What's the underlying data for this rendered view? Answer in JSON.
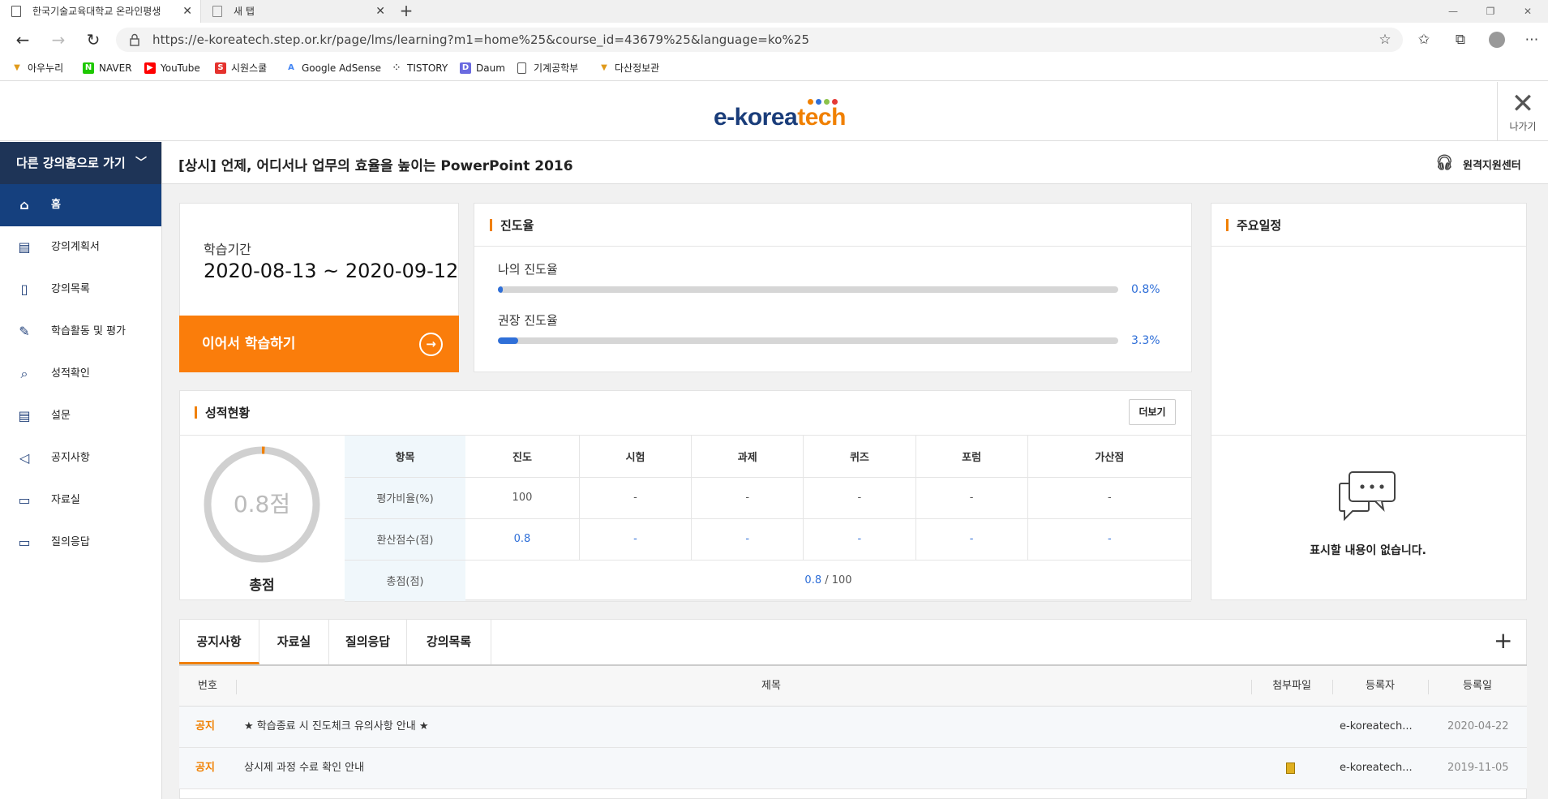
{
  "browser": {
    "tabs": [
      {
        "title": "한국기술교육대학교 온라인평생",
        "active": true
      },
      {
        "title": "새 탭",
        "active": false
      }
    ],
    "url": "https://e-koreatech.step.or.kr/page/lms/learning?m1=home%25&course_id=43679%25&language=ko%25",
    "bookmarks": [
      {
        "label": "아우누리",
        "icon": "shield-icon",
        "color": "#e09a1a"
      },
      {
        "label": "NAVER",
        "icon": "naver-icon",
        "color": "#1ec800"
      },
      {
        "label": "YouTube",
        "icon": "youtube-icon",
        "color": "#ff0000"
      },
      {
        "label": "시원스쿨",
        "icon": "s-icon",
        "color": "#e5322d"
      },
      {
        "label": "Google AdSense",
        "icon": "adsense-icon",
        "color": "#4285f4"
      },
      {
        "label": "TISTORY",
        "icon": "tistory-icon",
        "color": "#333333"
      },
      {
        "label": "Daum",
        "icon": "daum-icon",
        "color": "#6a6ae0"
      },
      {
        "label": "기계공학부",
        "icon": "page-icon",
        "color": "#555555"
      },
      {
        "label": "다산정보관",
        "icon": "shield-icon",
        "color": "#e09a1a"
      }
    ]
  },
  "site": {
    "logo_e": "e-korea",
    "logo_t": "tech",
    "exit_label": "나가기"
  },
  "sidebar": {
    "top_label": "다른 강의홈으로 가기",
    "items": [
      {
        "label": "홈",
        "icon": "home-icon",
        "active": true
      },
      {
        "label": "강의계획서",
        "icon": "book-open-icon"
      },
      {
        "label": "강의목록",
        "icon": "book-icon"
      },
      {
        "label": "학습활동 및 평가",
        "icon": "edit-icon"
      },
      {
        "label": "성적확인",
        "icon": "search-icon"
      },
      {
        "label": "설문",
        "icon": "document-icon"
      },
      {
        "label": "공지사항",
        "icon": "megaphone-icon"
      },
      {
        "label": "자료실",
        "icon": "folder-icon"
      },
      {
        "label": "질의응답",
        "icon": "chat-icon"
      }
    ]
  },
  "course": {
    "title": "[상시] 언제, 어디서나 업무의 효율을 높이는 PowerPoint 2016",
    "remote_label": "원격지원센터"
  },
  "period": {
    "label": "학습기간",
    "value": "2020-08-13 ~ 2020-09-12",
    "continue_label": "이어서 학습하기"
  },
  "progress": {
    "title": "진도율",
    "mine_label": "나의 진도율",
    "mine_value": "0.8%",
    "mine_fraction": 0.008,
    "rec_label": "권장 진도율",
    "rec_value": "3.3%",
    "rec_fraction": 0.033
  },
  "grades": {
    "title": "성적현황",
    "more_label": "더보기",
    "score_text": "0.8점",
    "score_fraction": 0.008,
    "total_label": "총점",
    "header": [
      "항목",
      "진도",
      "시험",
      "과제",
      "퀴즈",
      "포럼",
      "가산점"
    ],
    "rows": [
      [
        "평가비율(%)",
        "100",
        "-",
        "-",
        "-",
        "-",
        "-"
      ],
      [
        "환산점수(점)",
        "0.8",
        "-",
        "-",
        "-",
        "-",
        "-"
      ]
    ],
    "total_row_label": "총점(점)",
    "total_score": "0.8",
    "total_max": " / 100"
  },
  "schedule": {
    "title": "주요일정",
    "empty_text": "표시할 내용이 없습니다."
  },
  "board": {
    "tabs": [
      "공지사항",
      "자료실",
      "질의응답",
      "강의목록"
    ],
    "columns": [
      "번호",
      "제목",
      "첨부파일",
      "등록자",
      "등록일"
    ],
    "rows": [
      {
        "no": "공지",
        "title": "★ 학습종료 시 진도체크 유의사항 안내 ★",
        "attach": "",
        "author": "e-koreatech...",
        "date": "2020-04-22"
      },
      {
        "no": "공지",
        "title": "상시제 과정 수료 확인 안내",
        "attach": "file-icon",
        "author": "e-koreatech...",
        "date": "2019-11-05"
      }
    ]
  }
}
